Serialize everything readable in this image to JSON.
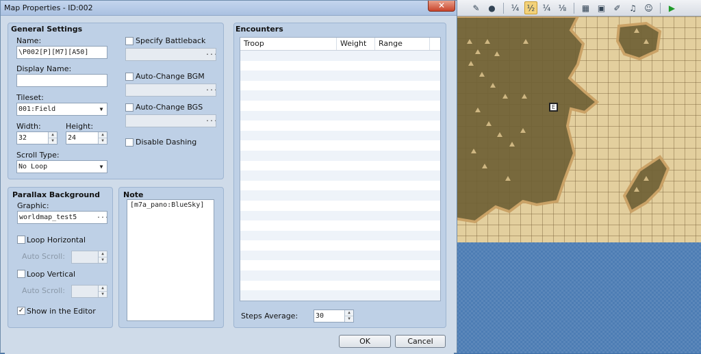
{
  "window": {
    "title": "Map Properties - ID:002",
    "close_glyph": "✕"
  },
  "general": {
    "heading": "General Settings",
    "name_label": "Name:",
    "name_value": "\\P002[P][M7][A50]",
    "display_name_label": "Display Name:",
    "display_name_value": "",
    "tileset_label": "Tileset:",
    "tileset_value": "001:Field",
    "width_label": "Width:",
    "width_value": "32",
    "height_label": "Height:",
    "height_value": "24",
    "scroll_type_label": "Scroll Type:",
    "scroll_type_value": "No Loop",
    "specify_battleback_label": "Specify Battleback",
    "auto_change_bgm_label": "Auto-Change BGM",
    "auto_change_bgs_label": "Auto-Change BGS",
    "disable_dashing_label": "Disable Dashing",
    "ellipsis": "..."
  },
  "parallax": {
    "heading": "Parallax Background",
    "graphic_label": "Graphic:",
    "graphic_value": "worldmap_test5",
    "loop_horizontal_label": "Loop Horizontal",
    "loop_vertical_label": "Loop Vertical",
    "auto_scroll_label": "Auto Scroll:",
    "show_in_editor_label": "Show in the Editor",
    "show_in_editor_checked": true,
    "check_glyph": "✓"
  },
  "note": {
    "heading": "Note",
    "value": "[m7a_pano:BlueSky]"
  },
  "encounters": {
    "heading": "Encounters",
    "columns": [
      "Troop",
      "Weight",
      "Range"
    ],
    "steps_average_label": "Steps Average:",
    "steps_average_value": "30"
  },
  "buttons": {
    "ok": "OK",
    "cancel": "Cancel"
  },
  "editor": {
    "toolbar_icons": [
      "pencil-icon",
      "circle-icon",
      "quarter-zoom-icon",
      "half-zoom-icon",
      "quarter-zoom-alt-icon",
      "eighth-zoom-icon",
      "database-icon",
      "resource-icon",
      "script-icon",
      "sound-icon",
      "character-icon",
      "play-icon"
    ],
    "active_tool": "half-zoom-icon",
    "colors": {
      "land": "#e3cf9e",
      "cliff": "#6f6135",
      "void": "#4d7db4"
    },
    "event_marker_glyph": "E"
  }
}
